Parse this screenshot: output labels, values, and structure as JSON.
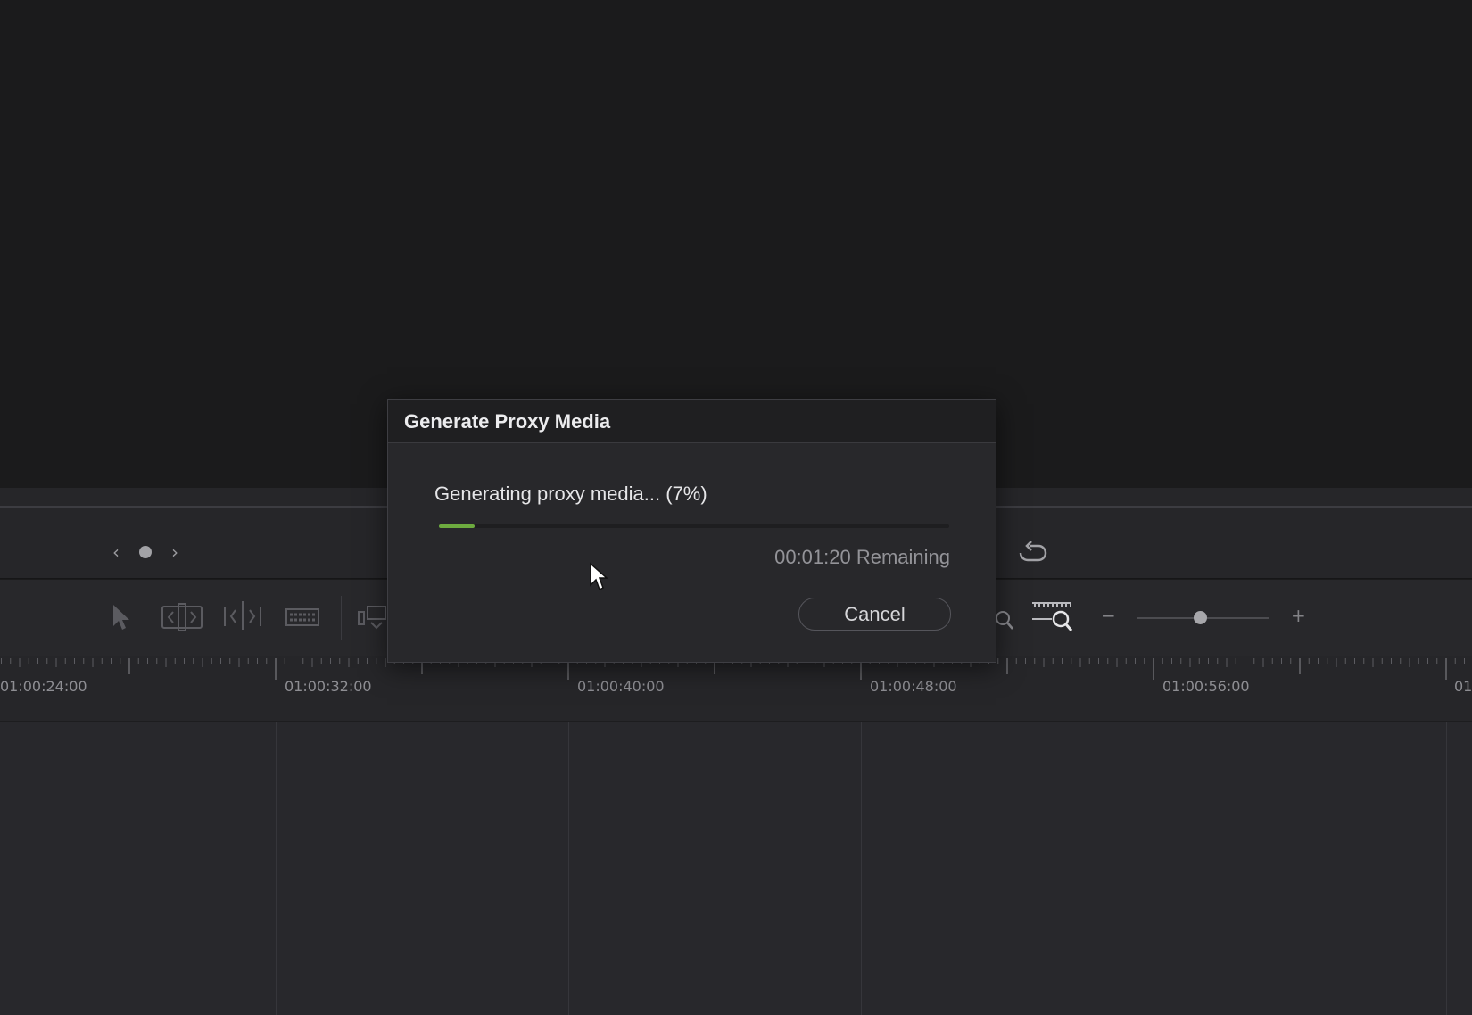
{
  "dialog": {
    "title": "Generate Proxy Media",
    "status_text": "Generating proxy media... (7%)",
    "progress_fraction": 0.07,
    "remaining_text": "00:01:20 Remaining",
    "cancel_label": "Cancel",
    "accent_color": "#6dab3f"
  },
  "transport": {
    "prev_icon": "chevron-left-icon",
    "dot_icon": "dot-icon",
    "next_icon": "chevron-right-icon",
    "loop_icon": "loop-icon"
  },
  "toolbar": {
    "tools": [
      "selection-pointer-icon",
      "trim-edit-icon",
      "dynamic-trim-icon",
      "blade-icon",
      "insert-clip-icon",
      "zoom-to-fit-icon",
      "zoom-custom-ruler-icon"
    ],
    "zoom_minus_label": "−",
    "zoom_plus_label": "+",
    "zoom_slider_value": 0.47
  },
  "ruler": {
    "timecodes": [
      "01:00:24:00",
      "01:00:32:00",
      "01:00:40:00",
      "01:00:48:00",
      "01:00:56:00",
      "01"
    ]
  }
}
